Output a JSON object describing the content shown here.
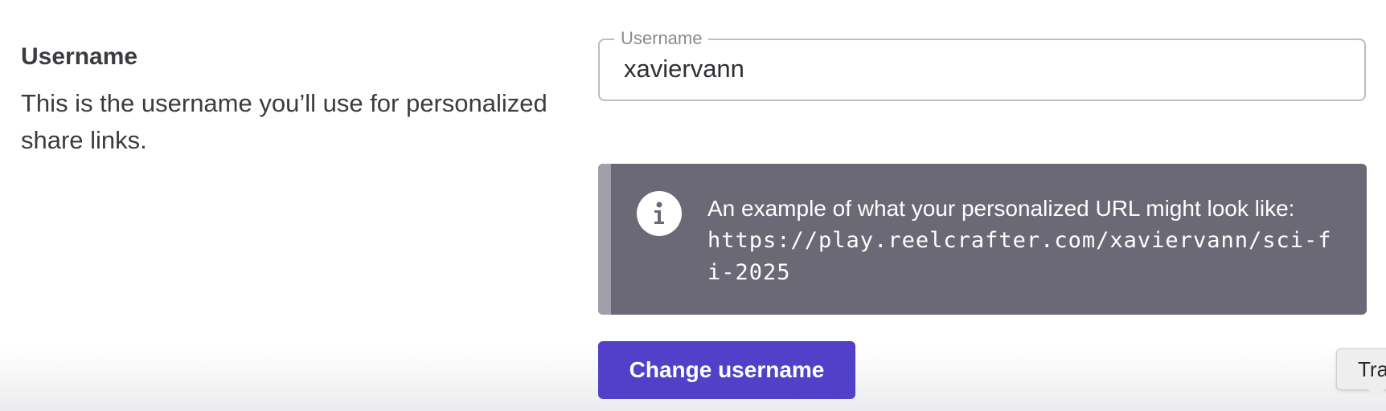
{
  "section": {
    "title": "Username",
    "description": "This is the username you’ll use for personalized share links."
  },
  "username_field": {
    "label": "Username",
    "value": "xaviervann"
  },
  "info": {
    "icon": "info-icon",
    "message": "An example of what your personalized URL might look like:",
    "url": "https://play.reelcrafter.com/xaviervann/sci-fi-2025"
  },
  "actions": {
    "change_label": "Change username"
  },
  "translate_widget": {
    "label": "Tra"
  },
  "colors": {
    "primary_button": "#5340c9",
    "info_background": "#6b6976",
    "info_accent": "#a19fa9"
  }
}
